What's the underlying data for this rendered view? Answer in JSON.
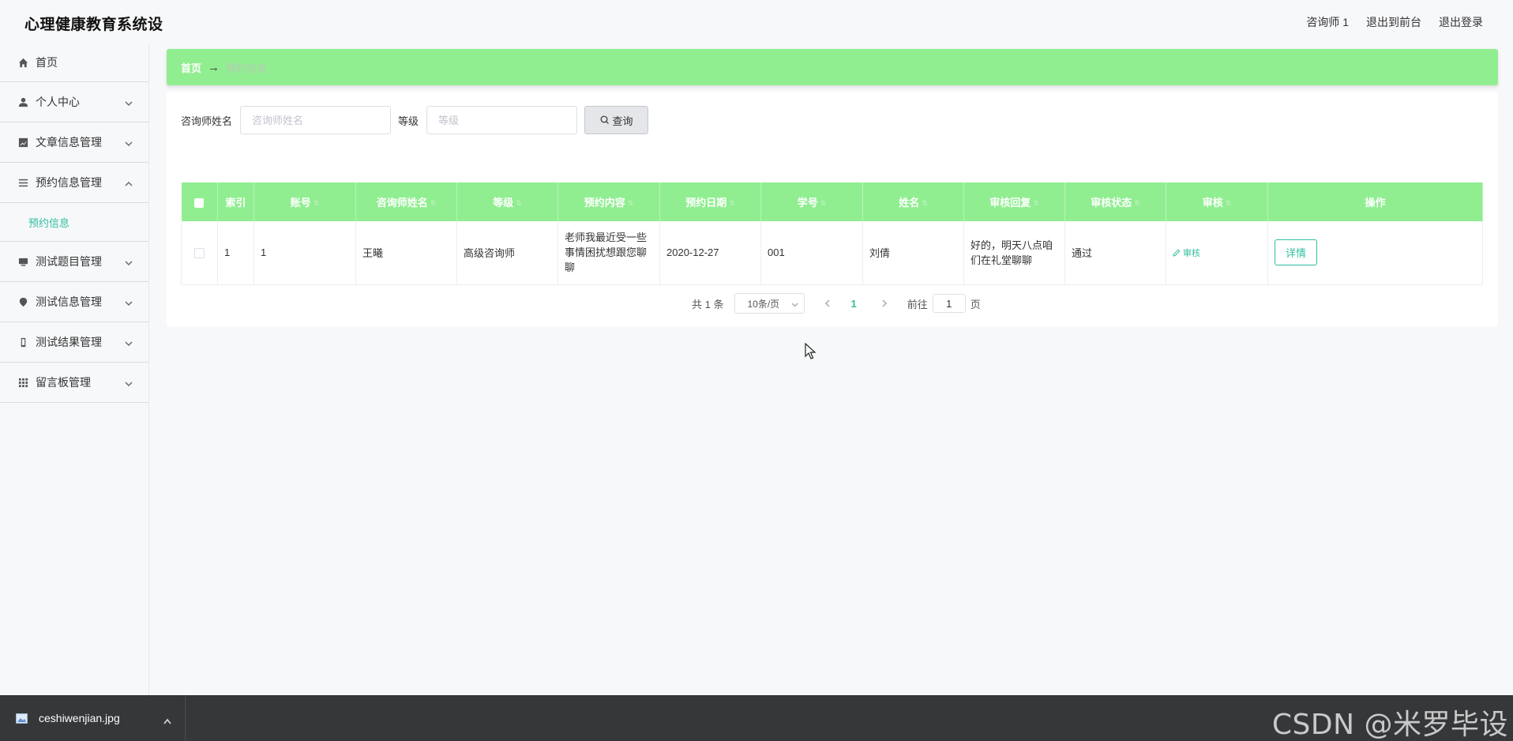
{
  "header": {
    "app_title": "心理健康教育系统设",
    "user_label": "咨询师 1",
    "front_link": "退出到前台",
    "logout_link": "退出登录"
  },
  "sidebar": {
    "items": [
      {
        "label": "首页",
        "icon": "home-icon"
      },
      {
        "label": "个人中心",
        "icon": "user-icon"
      },
      {
        "label": "文章信息管理",
        "icon": "chart-icon"
      },
      {
        "label": "预约信息管理",
        "icon": "list-icon",
        "expanded": true
      },
      {
        "label": "测试题目管理",
        "icon": "monitor-icon"
      },
      {
        "label": "测试信息管理",
        "icon": "pin-icon"
      },
      {
        "label": "测试结果管理",
        "icon": "phone-icon"
      },
      {
        "label": "留言板管理",
        "icon": "grid-icon"
      }
    ],
    "submenu_active": "预约信息"
  },
  "breadcrumb": {
    "home": "首页",
    "separator": "→",
    "current": "预约信息"
  },
  "search": {
    "counselor_label": "咨询师姓名",
    "counselor_placeholder": "咨询师姓名",
    "counselor_value": "",
    "level_label": "等级",
    "level_placeholder": "等级",
    "level_value": "",
    "query_button": "查询"
  },
  "table": {
    "columns": [
      "索引",
      "账号",
      "咨询师姓名",
      "等级",
      "预约内容",
      "预约日期",
      "学号",
      "姓名",
      "审核回复",
      "审核状态",
      "审核",
      "操作"
    ],
    "rows": [
      {
        "index": "1",
        "account": "1",
        "counselor": "王曦",
        "level": "高级咨询师",
        "content": "老师我最近受一些事情困扰想跟您聊聊",
        "date": "2020-12-27",
        "student_no": "001",
        "name": "刘倩",
        "reply": "好的，明天八点咱们在礼堂聊聊",
        "status": "通过",
        "audit_label": "审核",
        "detail_label": "详情"
      }
    ]
  },
  "pagination": {
    "total": "共 1 条",
    "page_size": "10条/页",
    "current_page": "1",
    "goto_label": "前往",
    "goto_value": "1",
    "page_suffix": "页"
  },
  "taskbar": {
    "download_file": "ceshiwenjian.jpg",
    "watermark": "CSDN @米罗毕设"
  },
  "colors": {
    "accent_green": "#90ee90",
    "link_teal": "#2fbfa0",
    "taskbar": "#353739"
  }
}
